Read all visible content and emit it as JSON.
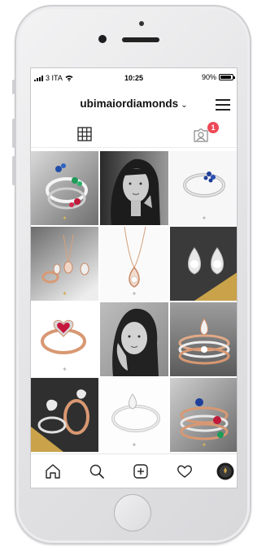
{
  "status_bar": {
    "carrier": "3 ITA",
    "time": "10:25",
    "battery_text": "90%",
    "battery_level": 0.9,
    "icons": [
      "signal-bars-icon",
      "wifi-icon",
      "battery-icon"
    ]
  },
  "profile": {
    "username": "ubimaiordiamonds",
    "username_dropdown_icon": "chevron-down-icon",
    "menu_icon": "hamburger-menu-icon"
  },
  "tabs": {
    "grid_icon": "grid-icon",
    "tagged_icon": "tagged-photos-icon",
    "tagged_badge_count": "1"
  },
  "posts": [
    {
      "subject": "gemstone rings blue green red"
    },
    {
      "subject": "portrait woman"
    },
    {
      "subject": "blue sapphire ring"
    },
    {
      "subject": "rose gold jewelry set"
    },
    {
      "subject": "rose gold pendant necklace"
    },
    {
      "subject": "diamond earrings"
    },
    {
      "subject": "ruby heart ring"
    },
    {
      "subject": "portrait woman"
    },
    {
      "subject": "stacked diamond rings"
    },
    {
      "subject": "leaf diamond rings"
    },
    {
      "subject": "diamond solitaire ring"
    },
    {
      "subject": "stacked gemstone rings"
    }
  ],
  "bottom_nav": {
    "items": [
      "home-icon",
      "search-icon",
      "new-post-icon",
      "activity-heart-icon",
      "profile-avatar-icon"
    ]
  },
  "colors": {
    "badge": "#ed4956",
    "watermark_gold": "#d2b05a"
  }
}
